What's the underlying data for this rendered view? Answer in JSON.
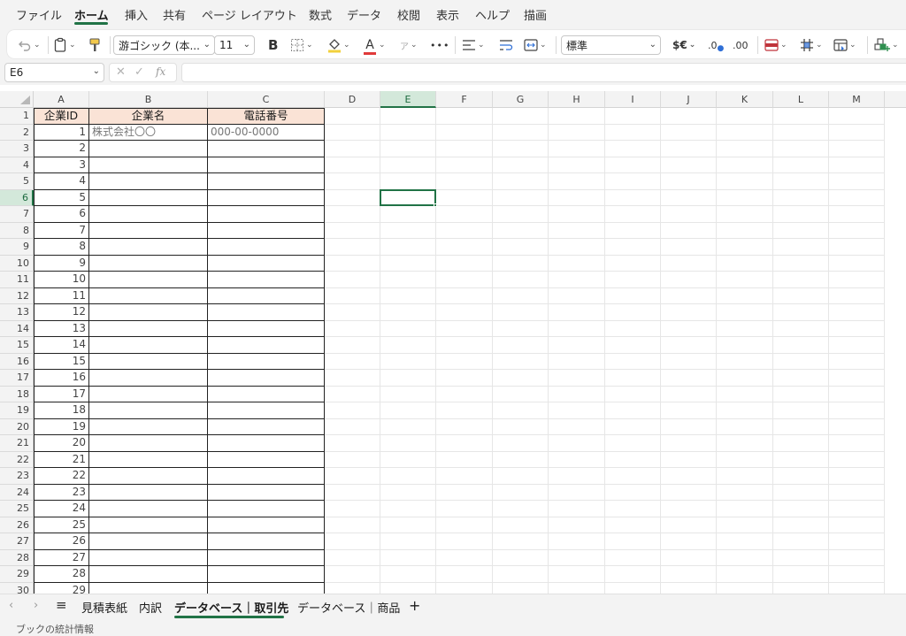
{
  "menu": {
    "tabs": [
      "ファイル",
      "ホーム",
      "挿入",
      "共有",
      "ページ レイアウト",
      "数式",
      "データ",
      "校閲",
      "表示",
      "ヘルプ",
      "描画"
    ],
    "active": "ホーム"
  },
  "ribbon": {
    "undo_icon": "undo-icon",
    "paste_icon": "clipboard-icon",
    "format_painter_icon": "format-painter-icon",
    "font_name": "游ゴシック (本...",
    "font_size": "11",
    "bold_label": "B",
    "font_color_label": "A",
    "phonetic_label": "ア",
    "more_label": "•••",
    "number_format": "標準",
    "currency_label": "$€",
    "increase_decimal_label": ".0",
    "decrease_decimal_label": ".00",
    "accent_color": "#217346",
    "font_color": "#e03a3a",
    "fill_color": "#f2d03b"
  },
  "formula_bar": {
    "name_box": "E6",
    "cancel": "✕",
    "enter": "✓",
    "fx": "fx",
    "value": ""
  },
  "sheet": {
    "columns": [
      "A",
      "B",
      "C",
      "D",
      "E",
      "F",
      "G",
      "H",
      "I",
      "J",
      "K",
      "L",
      "M"
    ],
    "selected_column": "E",
    "selected_row": 6,
    "headers": [
      "企業ID",
      "企業名",
      "電話番号"
    ],
    "header_fill": "#fae3d6",
    "rows": [
      {
        "row": "1"
      },
      {
        "row": "2",
        "id": "1",
        "name": "株式会社〇〇",
        "phone": "000-00-0000"
      },
      {
        "row": "3",
        "id": "2"
      },
      {
        "row": "4",
        "id": "3"
      },
      {
        "row": "5",
        "id": "4"
      },
      {
        "row": "6",
        "id": "5"
      },
      {
        "row": "7",
        "id": "6"
      },
      {
        "row": "8",
        "id": "7"
      },
      {
        "row": "9",
        "id": "8"
      },
      {
        "row": "10",
        "id": "9"
      },
      {
        "row": "11",
        "id": "10"
      },
      {
        "row": "12",
        "id": "11"
      },
      {
        "row": "13",
        "id": "12"
      },
      {
        "row": "14",
        "id": "13"
      },
      {
        "row": "15",
        "id": "14"
      },
      {
        "row": "16",
        "id": "15"
      },
      {
        "row": "17",
        "id": "16"
      },
      {
        "row": "18",
        "id": "17"
      },
      {
        "row": "19",
        "id": "18"
      },
      {
        "row": "20",
        "id": "19"
      },
      {
        "row": "21",
        "id": "20"
      },
      {
        "row": "22",
        "id": "21"
      },
      {
        "row": "23",
        "id": "22"
      },
      {
        "row": "24",
        "id": "23"
      },
      {
        "row": "25",
        "id": "24"
      },
      {
        "row": "26",
        "id": "25"
      },
      {
        "row": "27",
        "id": "26"
      },
      {
        "row": "28",
        "id": "27"
      },
      {
        "row": "29",
        "id": "28"
      },
      {
        "row": "30",
        "id": "29"
      }
    ]
  },
  "sheet_tabs": {
    "tabs": [
      "見積表紙",
      "内訳",
      "データベース｜取引先",
      "データベース｜商品"
    ],
    "active": "データベース｜取引先",
    "prev": "‹",
    "next": "›",
    "menu": "≡",
    "add": "+"
  },
  "status": {
    "text": "ブックの統計情報"
  }
}
